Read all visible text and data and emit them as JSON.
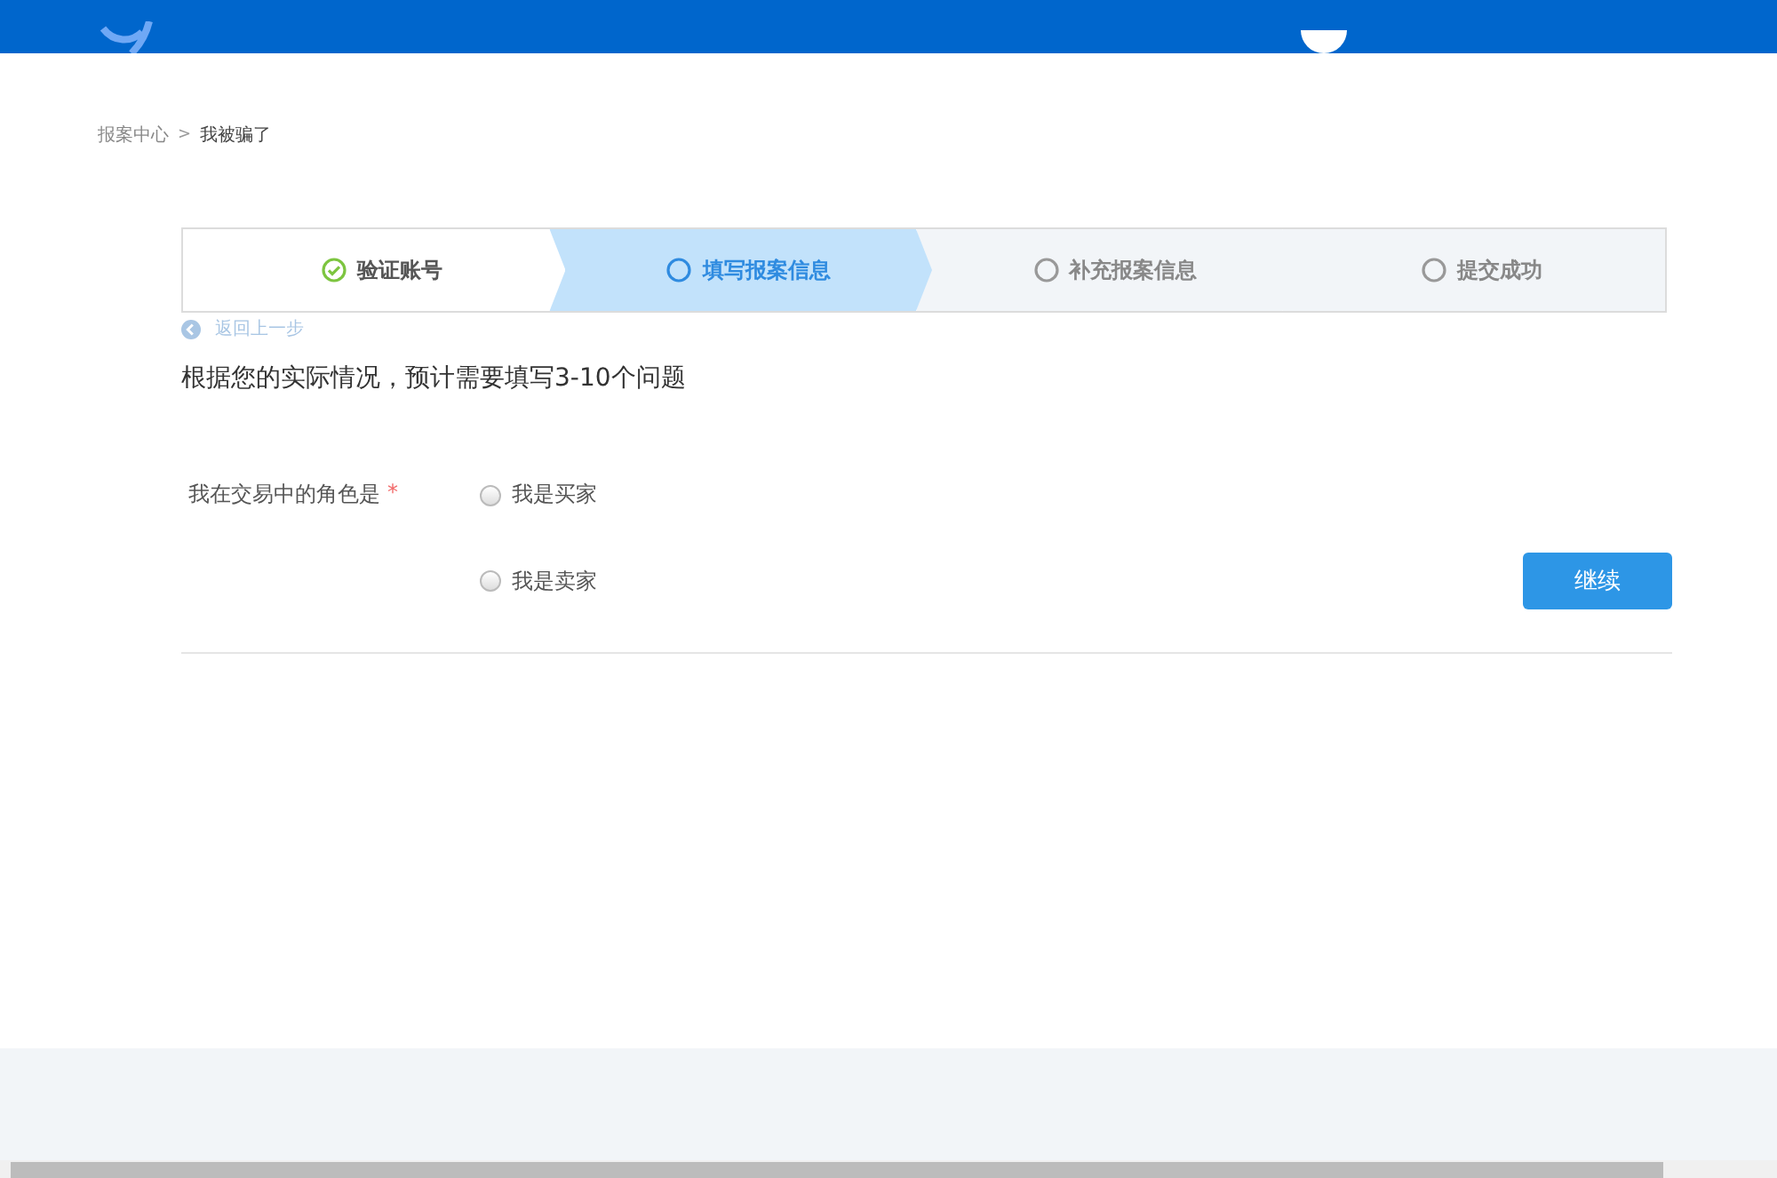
{
  "breadcrumb": [
    {
      "label": "报案中心"
    },
    {
      "label": "我被骗了"
    }
  ],
  "breadcrumb_separator": ">",
  "steps": [
    {
      "label": "验证账号",
      "completed": true,
      "selected": false
    },
    {
      "label": "填写报案信息",
      "completed": false,
      "selected": true
    },
    {
      "label": "补充报案信息",
      "completed": false,
      "selected": false
    },
    {
      "label": "提交成功",
      "completed": false,
      "selected": false
    }
  ],
  "back_link": "返回上一步",
  "intro": "根据您的实际情况，预计需要填写3-10个问题",
  "question": {
    "label": "我在交易中的角色是",
    "required_mark": "*",
    "options": [
      {
        "label": "我是买家",
        "selected": false
      },
      {
        "label": "我是卖家",
        "selected": false
      }
    ]
  },
  "continue_button": "继续"
}
